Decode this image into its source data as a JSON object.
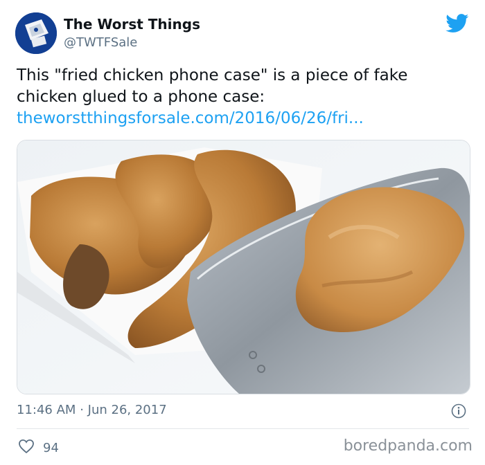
{
  "tweet": {
    "author_name": "The Worst Things",
    "author_handle": "@TWTFSale",
    "text": "This \"fried chicken phone case\" is a piece of fake chicken glued to a phone case:",
    "link": "theworstthingsforsale.com/2016/06/26/fri...",
    "time": "11:46 AM",
    "separator": "·",
    "date": "Jun 26, 2017",
    "likes": "94"
  },
  "icons": {
    "platform": "twitter-bird-icon",
    "info": "info-icon",
    "like": "heart-icon"
  },
  "colors": {
    "link": "#1da1f2",
    "twitter_blue": "#1da1f2",
    "secondary_text": "#5b7083"
  },
  "watermark": "boredpanda.com"
}
